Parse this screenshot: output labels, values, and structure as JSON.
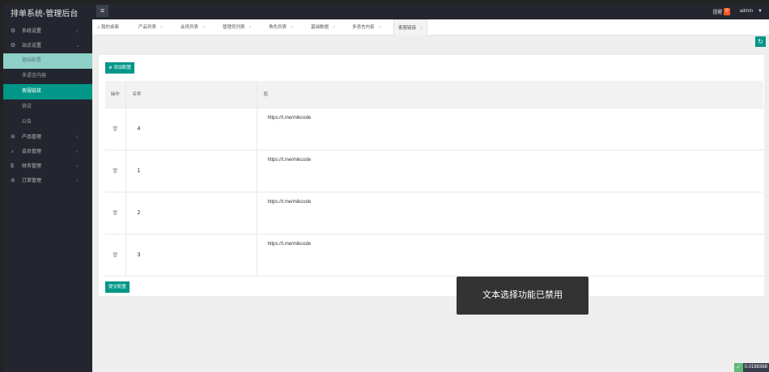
{
  "app": {
    "title": "排单系统-管理后台"
  },
  "header": {
    "menu_icon": "≡",
    "remind_label": "提醒",
    "remind_count": "0",
    "user": "admin",
    "user_caret": "▼"
  },
  "sidebar": {
    "items": [
      {
        "icon": "⚙",
        "label": "系统设置",
        "arrow": "‹"
      },
      {
        "icon": "⚙",
        "label": "站点设置",
        "arrow": "⌄"
      }
    ],
    "subitems": [
      {
        "label": "基础配置"
      },
      {
        "label": "多语言内容"
      },
      {
        "label": "客服链接"
      },
      {
        "label": "协议"
      },
      {
        "label": "公告"
      }
    ],
    "items2": [
      {
        "icon": "⊚",
        "label": "产品管理",
        "arrow": "‹"
      },
      {
        "icon": "♁",
        "label": "会员管理",
        "arrow": "‹"
      },
      {
        "icon": "$",
        "label": "财务管理",
        "arrow": "‹"
      },
      {
        "icon": "⊚",
        "label": "订单管理",
        "arrow": "‹"
      }
    ]
  },
  "tabs": [
    {
      "label": "我的桌面",
      "icon": "⌂"
    },
    {
      "label": "产品列表",
      "close": "×"
    },
    {
      "label": "会员列表",
      "close": "×"
    },
    {
      "label": "管理员列表",
      "close": "×"
    },
    {
      "label": "角色列表",
      "close": "×"
    },
    {
      "label": "基础数据",
      "close": "×"
    },
    {
      "label": "多语言内容",
      "close": "×"
    },
    {
      "label": "客服链接",
      "close": "×"
    }
  ],
  "refresh_icon": "↻",
  "main": {
    "add_button": "添加配置",
    "add_icon": "⊕",
    "submit_button": "提交配置",
    "table": {
      "col_action": "操作",
      "col_name": "名称",
      "col_value": "值",
      "rows": [
        {
          "name": "4",
          "value": "https://t.me/mikcode"
        },
        {
          "name": "1",
          "value": "https://t.me/mikcode"
        },
        {
          "name": "2",
          "value": "https://t.me/mikcode"
        },
        {
          "name": "3",
          "value": "https://t.me/mikcode"
        }
      ]
    },
    "trash_icon": "🗑"
  },
  "toast": "文本选择功能已禁用",
  "perf": {
    "icon": "✓",
    "value": "0.0198368"
  },
  "colors": {
    "accent": "#009688",
    "topbar": "#23262e",
    "badge": "#ff5722"
  }
}
